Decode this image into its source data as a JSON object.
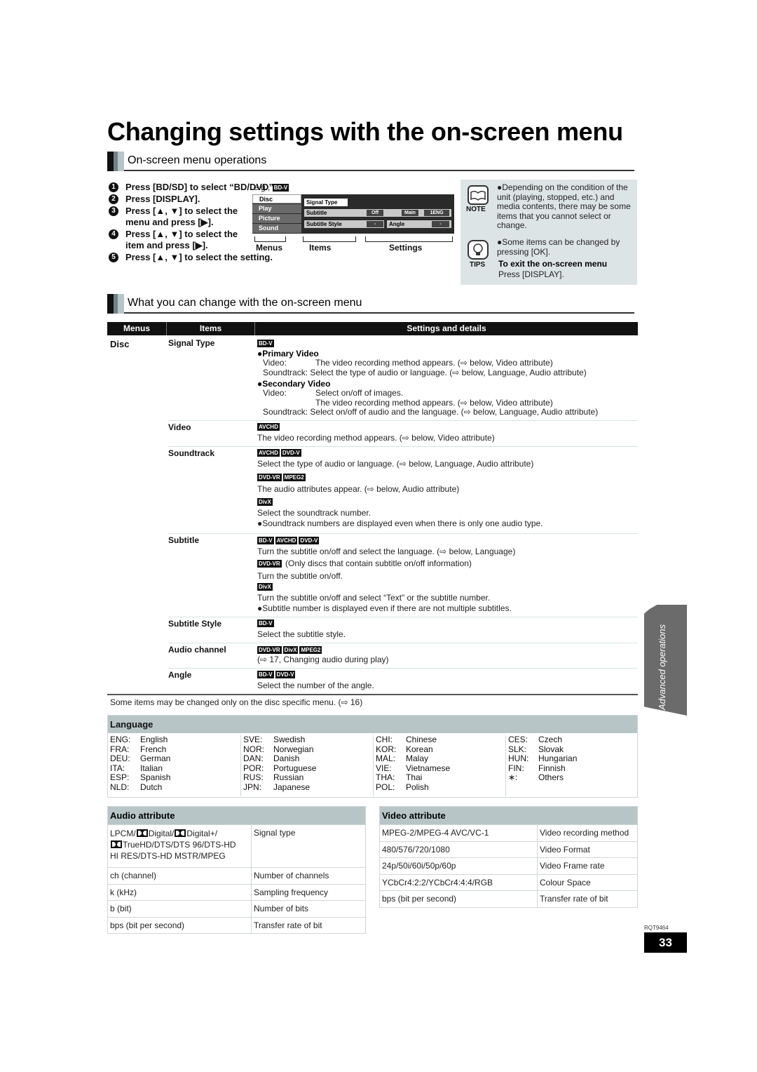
{
  "page": {
    "title": "Changing settings with the on-screen menu",
    "doc_id": "RQT9464",
    "page_number": "33",
    "side_tab": "Advanced operations"
  },
  "section1": {
    "heading": "On-screen menu operations",
    "steps": [
      {
        "num": "1",
        "text": "Press [BD/SD] to select “BD/DVD”."
      },
      {
        "num": "2",
        "text": "Press [DISPLAY]."
      },
      {
        "num": "3",
        "text": "Press [▲, ▼] to select the menu and press [▶]."
      },
      {
        "num": "4",
        "text": "Press [▲, ▼] to select the item and press [▶]."
      },
      {
        "num": "5",
        "text": "Press [▲, ▼] to select the setting."
      }
    ],
    "example": {
      "prefix": "e.g.,",
      "tag": "BD-V",
      "menus": [
        "Disc",
        "Play",
        "Picture",
        "Sound"
      ],
      "items": {
        "signal_type": "Signal Type",
        "subtitle": "Subtitle",
        "subtitle_style": "Subtitle Style",
        "angle": "Angle"
      },
      "values": {
        "subtitle_off": "Off",
        "subtitle_main": "Main",
        "subtitle_lang": "1ENG",
        "style": "-",
        "angle": "-"
      },
      "labels": {
        "menus": "Menus",
        "items": "Items",
        "settings": "Settings"
      }
    },
    "note": {
      "icon_label": "NOTE",
      "text": "●Depending on the condition of the unit (playing, stopped, etc.) and media contents, there may be some items that you cannot select or change."
    },
    "tips": {
      "icon_label": "TIPS",
      "text": "●Some items can be changed by pressing [OK].",
      "exit_title": "To exit the on-screen menu",
      "exit_text": "Press [DISPLAY]."
    }
  },
  "section2": {
    "heading": "What you can change with the on-screen menu",
    "columns": [
      "Menus",
      "Items",
      "Settings and details"
    ],
    "menu": "Disc",
    "rows": {
      "signal_type": {
        "item": "Signal Type",
        "tags": [
          "BD-V"
        ],
        "primary_title": "●Primary Video",
        "primary_video_label": "Video:",
        "primary_video": "The video recording method appears. (⇨ below, Video attribute)",
        "primary_sound_label": "Soundtrack:",
        "primary_sound": "Select the type of audio or language. (⇨ below, Language, Audio attribute)",
        "secondary_title": "●Secondary Video",
        "secondary_video_label": "Video:",
        "secondary_video_1": "Select on/off of images.",
        "secondary_video_2": "The video recording method appears. (⇨ below, Video attribute)",
        "secondary_sound_label": "Soundtrack:",
        "secondary_sound": "Select on/off of audio and the language. (⇨ below, Language, Audio attribute)"
      },
      "video": {
        "item": "Video",
        "tags": [
          "AVCHD"
        ],
        "text": "The video recording method appears. (⇨ below, Video attribute)"
      },
      "soundtrack": {
        "item": "Soundtrack",
        "tags_1": [
          "AVCHD",
          "DVD-V"
        ],
        "text_1": "Select the type of audio or language. (⇨ below, Language, Audio attribute)",
        "tags_2": [
          "DVD-VR",
          "MPEG2"
        ],
        "text_2": "The audio attributes appear. (⇨ below, Audio attribute)",
        "tags_3": [
          "DivX"
        ],
        "text_3": "Select the soundtrack number.",
        "text_4": "●Soundtrack numbers are displayed even when there is only one audio type."
      },
      "subtitle": {
        "item": "Subtitle",
        "tags_1": [
          "BD-V",
          "AVCHD",
          "DVD-V"
        ],
        "text_1": "Turn the subtitle on/off and select the language. (⇨ below, Language)",
        "tags_2": [
          "DVD-VR"
        ],
        "text_2": "(Only discs that contain subtitle on/off information)",
        "text_3": "Turn the subtitle on/off.",
        "tags_3": [
          "DivX"
        ],
        "text_4": "Turn the subtitle on/off and select “Text” or the subtitle number.",
        "text_5": "●Subtitle number is displayed even if there are not multiple subtitles."
      },
      "subtitle_style": {
        "item": "Subtitle Style",
        "tags": [
          "BD-V"
        ],
        "text": "Select the subtitle style."
      },
      "audio_channel": {
        "item": "Audio channel",
        "tags": [
          "DVD-VR",
          "DivX",
          "MPEG2"
        ],
        "text": "(⇨ 17, Changing audio during play)"
      },
      "angle": {
        "item": "Angle",
        "tags": [
          "BD-V",
          "DVD-V"
        ],
        "text": "Select the number of the angle."
      }
    },
    "footnote": "Some items may be changed only on the disc specific menu. (⇨ 16)"
  },
  "language": {
    "title": "Language",
    "columns": [
      [
        [
          "ENG:",
          "English"
        ],
        [
          "FRA:",
          "French"
        ],
        [
          "DEU:",
          "German"
        ],
        [
          "ITA:",
          "Italian"
        ],
        [
          "ESP:",
          "Spanish"
        ],
        [
          "NLD:",
          "Dutch"
        ]
      ],
      [
        [
          "SVE:",
          "Swedish"
        ],
        [
          "NOR:",
          "Norwegian"
        ],
        [
          "DAN:",
          "Danish"
        ],
        [
          "POR:",
          "Portuguese"
        ],
        [
          "RUS:",
          "Russian"
        ],
        [
          "JPN:",
          "Japanese"
        ]
      ],
      [
        [
          "CHI:",
          "Chinese"
        ],
        [
          "KOR:",
          "Korean"
        ],
        [
          "MAL:",
          "Malay"
        ],
        [
          "VIE:",
          "Vietnamese"
        ],
        [
          "THA:",
          "Thai"
        ],
        [
          "POL:",
          "Polish"
        ]
      ],
      [
        [
          "CES:",
          "Czech"
        ],
        [
          "SLK:",
          "Slovak"
        ],
        [
          "HUN:",
          "Hungarian"
        ],
        [
          "FIN:",
          "Finnish"
        ],
        [
          "∗:",
          "Others"
        ]
      ]
    ]
  },
  "audio_attribute": {
    "title": "Audio attribute",
    "first_row": {
      "part1": "LPCM/",
      "part2": "Digital/",
      "part3": "Digital+/",
      "part4": "TrueHD/DTS/DTS 96/DTS-HD",
      "part5": "HI RES/DTS-HD MSTR/MPEG",
      "meaning": "Signal type"
    },
    "rows": [
      [
        "ch (channel)",
        "Number of channels"
      ],
      [
        "k (kHz)",
        "Sampling frequency"
      ],
      [
        "b (bit)",
        "Number of bits"
      ],
      [
        "bps (bit per second)",
        "Transfer rate of bit"
      ]
    ]
  },
  "video_attribute": {
    "title": "Video attribute",
    "rows": [
      [
        "MPEG-2/MPEG-4 AVC/VC-1",
        "Video recording method"
      ],
      [
        "480/576/720/1080",
        "Video Format"
      ],
      [
        "24p/50i/60i/50p/60p",
        "Video Frame rate"
      ],
      [
        "YCbCr4:2:2/YCbCr4:4:4/RGB",
        "Colour Space"
      ],
      [
        "bps (bit per second)",
        "Transfer rate of bit"
      ]
    ]
  }
}
